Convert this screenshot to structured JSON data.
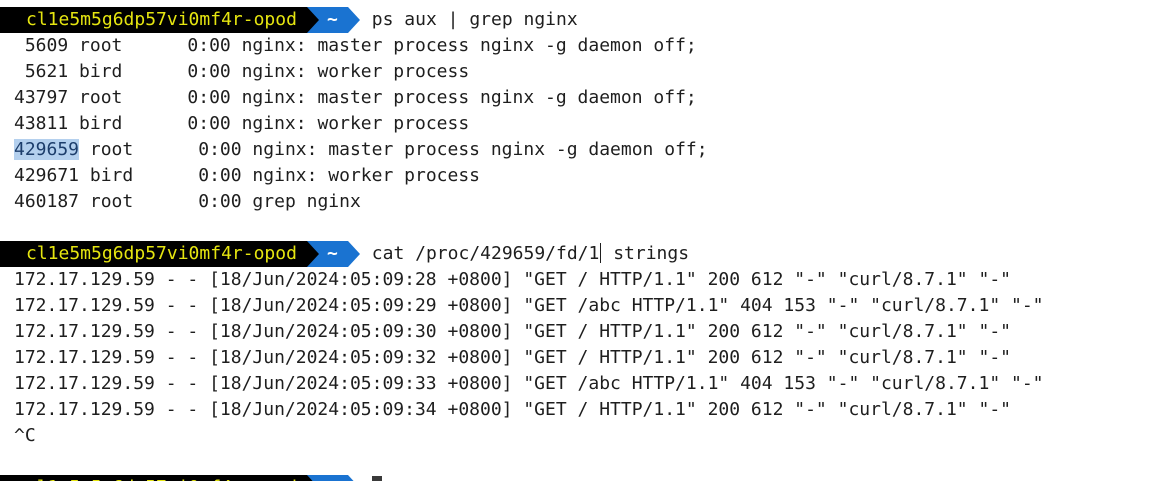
{
  "prompt": {
    "host": "cl1e5m5g6dp57vi0mf4r-opod",
    "dir": "~"
  },
  "commands": {
    "first": "ps aux | grep nginx",
    "second_before_cursor": "cat /proc/429659/fd/1",
    "second_after_cursor": " strings"
  },
  "ps_output": [
    {
      "pid": " 5609",
      "user": " root",
      "time": "      0:00",
      "command": " nginx: master process nginx -g daemon off;"
    },
    {
      "pid": " 5621",
      "user": " bird",
      "time": "      0:00",
      "command": " nginx: worker process"
    },
    {
      "pid": "43797",
      "user": " root",
      "time": "      0:00",
      "command": " nginx: master process nginx -g daemon off;"
    },
    {
      "pid": "43811",
      "user": " bird",
      "time": "      0:00",
      "command": " nginx: worker process"
    },
    {
      "pid": "429659",
      "user": " root",
      "time": "      0:00",
      "command": " nginx: master process nginx -g daemon off;"
    },
    {
      "pid": "429671",
      "user": " bird",
      "time": "      0:00",
      "command": " nginx: worker process"
    },
    {
      "pid": "460187",
      "user": " root",
      "time": "      0:00",
      "command": " grep nginx"
    }
  ],
  "log_output": [
    "172.17.129.59 - - [18/Jun/2024:05:09:28 +0800] \"GET / HTTP/1.1\" 200 612 \"-\" \"curl/8.7.1\" \"-\"",
    "172.17.129.59 - - [18/Jun/2024:05:09:29 +0800] \"GET /abc HTTP/1.1\" 404 153 \"-\" \"curl/8.7.1\" \"-\"",
    "172.17.129.59 - - [18/Jun/2024:05:09:30 +0800] \"GET / HTTP/1.1\" 200 612 \"-\" \"curl/8.7.1\" \"-\"",
    "172.17.129.59 - - [18/Jun/2024:05:09:32 +0800] \"GET / HTTP/1.1\" 200 612 \"-\" \"curl/8.7.1\" \"-\"",
    "172.17.129.59 - - [18/Jun/2024:05:09:33 +0800] \"GET /abc HTTP/1.1\" 404 153 \"-\" \"curl/8.7.1\" \"-\"",
    "172.17.129.59 - - [18/Jun/2024:05:09:34 +0800] \"GET / HTTP/1.1\" 200 612 \"-\" \"curl/8.7.1\" \"-\""
  ],
  "interrupt": "^C",
  "colors": {
    "host_bg": "#000000",
    "host_fg": "#e5e510",
    "dir_bg": "#1a73d1",
    "dir_fg": "#ffffff",
    "selection_bg": "#b4d0ee"
  }
}
